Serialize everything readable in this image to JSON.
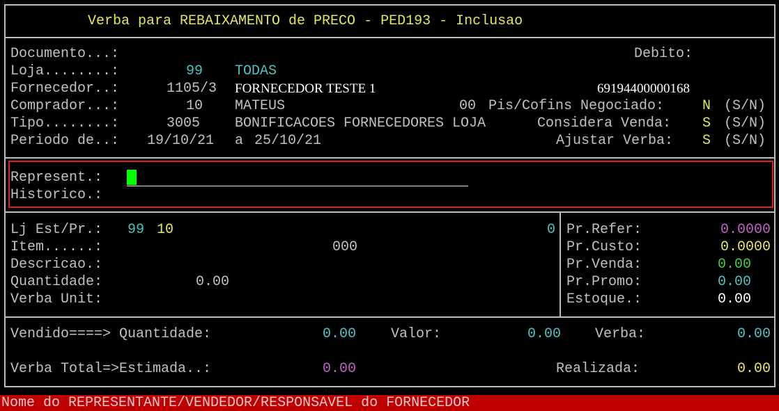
{
  "title": "Verba para REBAIXAMENTO de PRECO - PED193 - Inclusao",
  "header": {
    "documento_label": "Documento...:",
    "debito_label": "Debito:",
    "loja_label": "Loja........:",
    "loja_code": "99",
    "loja_name": "TODAS",
    "fornecedor_label": "Fornecedor..:",
    "fornecedor_code": "1105/3",
    "fornecedor_name": "FORNECEDOR TESTE 1",
    "fornecedor_cnpj": "69194400000168",
    "comprador_label": "Comprador...:",
    "comprador_code": "10",
    "comprador_name": "MATEUS",
    "comprador_extra": "00",
    "pis_label": "Pis/Cofins Negociado:",
    "pis_value": "N",
    "pis_opts": "(S/N)",
    "tipo_label": "Tipo........:",
    "tipo_code": "3005",
    "tipo_name": "BONIFICACOES FORNECEDORES LOJA",
    "considera_label": "Considera Venda:",
    "considera_value": "S",
    "considera_opts": "(S/N)",
    "periodo_label": "Periodo de..:",
    "periodo_start": "19/10/21",
    "periodo_sep": "a",
    "periodo_end": "25/10/21",
    "ajustar_label": "Ajustar Verba:",
    "ajustar_value": "S",
    "ajustar_opts": "(S/N)"
  },
  "form": {
    "represent_label": "Represent.:",
    "represent_value": "",
    "historico_label": "Historico.:",
    "historico_value": ""
  },
  "item": {
    "ljest_label": "Lj Est/Pr.:",
    "ljest_loja": "99",
    "ljest_est": "10",
    "ljest_right": "0",
    "item_label": "Item......:",
    "item_value": "000",
    "descricao_label": "Descricao.:",
    "quantidade_label": "Quantidade:",
    "quantidade_value": "0.00",
    "verbaunit_label": "Verba Unit:"
  },
  "prices": {
    "refer_label": "Pr.Refer:",
    "refer_value": "0.0000",
    "custo_label": "Pr.Custo:",
    "custo_value": "0.0000",
    "venda_label": "Pr.Venda:",
    "venda_value": "0.00",
    "promo_label": "Pr.Promo:",
    "promo_value": "0.00",
    "estoque_label": "Estoque.:",
    "estoque_value": "0.00"
  },
  "totals": {
    "vendido_label": "Vendido====> Quantidade:",
    "vendido_qtd": "0.00",
    "valor_label": "Valor:",
    "valor_value": "0.00",
    "verba_label": "Verba:",
    "verba_value": "0.00",
    "total_label": "Verba Total=>Estimada..:",
    "estimada_value": "0.00",
    "realizada_label": "Realizada:",
    "realizada_value": "0.00"
  },
  "status_bar": "Nome do REPRESENTANTE/VENDEDOR/RESPONSAVEL do FORNECEDOR",
  "colors": {
    "highlight_border": "#e02020",
    "status_bg": "#c00000",
    "cursor": "#00ff00"
  }
}
